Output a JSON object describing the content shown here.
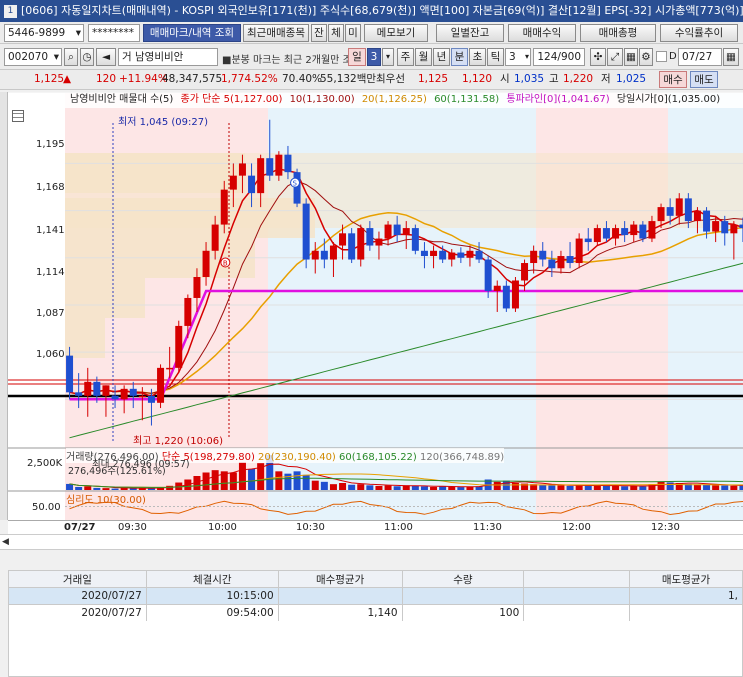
{
  "window": {
    "title": "[0606] 자동일지차트(매매내역) - KOSPI  외국인보유[171(천)]  주식수[68,679(천)]  액면[100]  자본금[69(억)]  결산[12월]  EPS[-32]  시가총액[773(억)]"
  },
  "toolbar1": {
    "account": "5446-9899",
    "password": "********",
    "buttons": [
      "매매마크/내역 조회",
      "최근매매종목",
      "잔",
      "체",
      "미",
      "메모보기",
      "일별잔고",
      "매매수익",
      "매매총평",
      "수익률추이"
    ]
  },
  "toolbar2": {
    "code": "002070",
    "mode": "거",
    "stock_name": "남영비비안",
    "notice": "■분봉 마크는 최근 2개월만 조회",
    "period_day": "일",
    "count_box": "3",
    "periods": [
      "주",
      "월",
      "년",
      "분",
      "초",
      "틱"
    ],
    "interval": "3",
    "paging": "124/900",
    "date": "07/27",
    "check_label": "D"
  },
  "quote": {
    "price": "1,125",
    "change": "120",
    "change_pct": "+11.94%",
    "volume": "48,347,575",
    "volume_pct": "1,774.52%",
    "ratio": "70.40%",
    "amount": "55,132백만",
    "best_label": "최우선",
    "best_ask": "1,125",
    "best_bid": "1,120",
    "open_label": "시",
    "open": "1,035",
    "high_label": "고",
    "high": "1,220",
    "low_label": "저",
    "low": "1,025",
    "buy_btn": "매수",
    "sell_btn": "매도"
  },
  "legend": {
    "name": "남영비비안 매물대 수(5)",
    "ma5": "종가 단순 5(1,127.00)",
    "ma10": "10(1,130.00)",
    "ma20": "20(1,126.25)",
    "ma60": "60(1,131.58)",
    "env": "통파라인[0](1,041.67)",
    "today": "당일시가[0](1,035.00)"
  },
  "price_axis": [
    "1,195",
    "1,168",
    "1,141",
    "1,114",
    "1,087",
    "1,060"
  ],
  "annotations": {
    "low": "최저 1,045 (09:27)",
    "high": "최고 1,220 (10:06)",
    "buy_mark": "B",
    "sell_mark": "S"
  },
  "volume_panel": {
    "legend_main": "거래량(276,496.00)",
    "legend_ma5": "단순 5(198,279.80)",
    "legend_ma20": "20(230,190.40)",
    "legend_ma60": "60(168,105.22)",
    "legend_ma120": "120(366,748.89)",
    "axis": "2,500K",
    "overlay1": "최대 276,496 (09:57)",
    "overlay2": "276,496주(125.61%)"
  },
  "psy_panel": {
    "legend": "심리도 10(30.00)",
    "axis": "50.00"
  },
  "time_axis": [
    "07/27",
    "09:30",
    "10:00",
    "10:30",
    "11:00",
    "11:30",
    "12:00",
    "12:30"
  ],
  "trade_table": {
    "headers": [
      "거래일",
      "체결시간",
      "매수평균가",
      "수량",
      "",
      "매도평균가"
    ],
    "rows": [
      [
        "2020/07/27",
        "10:15:00",
        "",
        "",
        "",
        "1,"
      ],
      [
        "2020/07/27",
        "09:54:00",
        "1,140",
        "100",
        "",
        ""
      ]
    ]
  },
  "colors": {
    "up": "#d60000",
    "down": "#1f4fd0",
    "ma5": "#d60000",
    "ma10": "#a01010",
    "ma20": "#e8a000",
    "ma60": "#2a8a2a",
    "env": "#e010e0"
  },
  "chart_data": {
    "type": "candlestick",
    "y_range": [
      1035,
      1225
    ],
    "candles": [
      {
        "o": 1085,
        "h": 1090,
        "l": 1060,
        "c": 1064,
        "t": "09:00"
      },
      {
        "o": 1064,
        "h": 1075,
        "l": 1055,
        "c": 1062,
        "t": "09:03"
      },
      {
        "o": 1062,
        "h": 1078,
        "l": 1050,
        "c": 1070,
        "t": "09:06"
      },
      {
        "o": 1070,
        "h": 1073,
        "l": 1058,
        "c": 1062,
        "t": "09:09"
      },
      {
        "o": 1062,
        "h": 1068,
        "l": 1050,
        "c": 1068,
        "t": "09:12"
      },
      {
        "o": 1062,
        "h": 1068,
        "l": 1055,
        "c": 1060,
        "t": "09:15"
      },
      {
        "o": 1060,
        "h": 1068,
        "l": 1052,
        "c": 1066,
        "t": "09:18"
      },
      {
        "o": 1066,
        "h": 1070,
        "l": 1055,
        "c": 1062,
        "t": "09:21"
      },
      {
        "o": 1062,
        "h": 1067,
        "l": 1048,
        "c": 1062,
        "t": "09:24"
      },
      {
        "o": 1062,
        "h": 1066,
        "l": 1045,
        "c": 1058,
        "t": "09:27"
      },
      {
        "o": 1058,
        "h": 1080,
        "l": 1055,
        "c": 1078,
        "t": "09:30"
      },
      {
        "o": 1078,
        "h": 1090,
        "l": 1072,
        "c": 1078,
        "t": "09:33"
      },
      {
        "o": 1078,
        "h": 1105,
        "l": 1075,
        "c": 1102,
        "t": "09:36"
      },
      {
        "o": 1102,
        "h": 1120,
        "l": 1095,
        "c": 1118,
        "t": "09:39"
      },
      {
        "o": 1118,
        "h": 1135,
        "l": 1110,
        "c": 1130,
        "t": "09:42"
      },
      {
        "o": 1130,
        "h": 1150,
        "l": 1125,
        "c": 1145,
        "t": "09:45"
      },
      {
        "o": 1145,
        "h": 1165,
        "l": 1140,
        "c": 1160,
        "t": "09:48"
      },
      {
        "o": 1160,
        "h": 1185,
        "l": 1155,
        "c": 1180,
        "t": "09:51"
      },
      {
        "o": 1180,
        "h": 1195,
        "l": 1170,
        "c": 1188,
        "t": "09:54"
      },
      {
        "o": 1188,
        "h": 1200,
        "l": 1178,
        "c": 1195,
        "t": "09:57"
      },
      {
        "o": 1188,
        "h": 1195,
        "l": 1170,
        "c": 1178,
        "t": "10:00"
      },
      {
        "o": 1178,
        "h": 1200,
        "l": 1170,
        "c": 1198,
        "t": "10:03"
      },
      {
        "o": 1198,
        "h": 1220,
        "l": 1185,
        "c": 1188,
        "t": "10:06"
      },
      {
        "o": 1188,
        "h": 1202,
        "l": 1185,
        "c": 1200,
        "t": "10:09"
      },
      {
        "o": 1200,
        "h": 1205,
        "l": 1186,
        "c": 1190,
        "t": "10:12"
      },
      {
        "o": 1190,
        "h": 1192,
        "l": 1170,
        "c": 1172,
        "t": "10:15"
      },
      {
        "o": 1172,
        "h": 1175,
        "l": 1135,
        "c": 1140,
        "t": "10:18"
      },
      {
        "o": 1140,
        "h": 1150,
        "l": 1132,
        "c": 1145,
        "t": "10:21"
      },
      {
        "o": 1145,
        "h": 1152,
        "l": 1135,
        "c": 1140,
        "t": "10:24"
      },
      {
        "o": 1140,
        "h": 1150,
        "l": 1130,
        "c": 1148,
        "t": "10:27"
      },
      {
        "o": 1148,
        "h": 1160,
        "l": 1140,
        "c": 1155,
        "t": "10:30"
      },
      {
        "o": 1155,
        "h": 1158,
        "l": 1138,
        "c": 1140,
        "t": "10:33"
      },
      {
        "o": 1140,
        "h": 1160,
        "l": 1136,
        "c": 1158,
        "t": "10:36"
      },
      {
        "o": 1158,
        "h": 1162,
        "l": 1145,
        "c": 1148,
        "t": "10:39"
      },
      {
        "o": 1148,
        "h": 1156,
        "l": 1140,
        "c": 1152,
        "t": "10:42"
      },
      {
        "o": 1152,
        "h": 1162,
        "l": 1148,
        "c": 1160,
        "t": "10:45"
      },
      {
        "o": 1160,
        "h": 1165,
        "l": 1150,
        "c": 1154,
        "t": "10:48"
      },
      {
        "o": 1154,
        "h": 1162,
        "l": 1146,
        "c": 1158,
        "t": "10:51"
      },
      {
        "o": 1158,
        "h": 1160,
        "l": 1143,
        "c": 1145,
        "t": "10:54"
      },
      {
        "o": 1145,
        "h": 1150,
        "l": 1135,
        "c": 1142,
        "t": "10:57"
      },
      {
        "o": 1142,
        "h": 1148,
        "l": 1135,
        "c": 1145,
        "t": "11:00"
      },
      {
        "o": 1145,
        "h": 1148,
        "l": 1138,
        "c": 1140,
        "t": "11:03"
      },
      {
        "o": 1140,
        "h": 1146,
        "l": 1136,
        "c": 1144,
        "t": "11:06"
      },
      {
        "o": 1144,
        "h": 1147,
        "l": 1138,
        "c": 1141,
        "t": "11:09"
      },
      {
        "o": 1141,
        "h": 1148,
        "l": 1136,
        "c": 1145,
        "t": "11:12"
      },
      {
        "o": 1145,
        "h": 1150,
        "l": 1138,
        "c": 1140,
        "t": "11:15"
      },
      {
        "o": 1140,
        "h": 1142,
        "l": 1118,
        "c": 1122,
        "t": "11:18"
      },
      {
        "o": 1122,
        "h": 1128,
        "l": 1110,
        "c": 1125,
        "t": "11:21"
      },
      {
        "o": 1125,
        "h": 1128,
        "l": 1110,
        "c": 1112,
        "t": "11:24"
      },
      {
        "o": 1112,
        "h": 1130,
        "l": 1110,
        "c": 1128,
        "t": "11:27"
      },
      {
        "o": 1128,
        "h": 1140,
        "l": 1122,
        "c": 1138,
        "t": "11:30"
      },
      {
        "o": 1138,
        "h": 1148,
        "l": 1132,
        "c": 1145,
        "t": "11:33"
      },
      {
        "o": 1145,
        "h": 1150,
        "l": 1136,
        "c": 1140,
        "t": "11:36"
      },
      {
        "o": 1140,
        "h": 1145,
        "l": 1130,
        "c": 1135,
        "t": "11:39"
      },
      {
        "o": 1135,
        "h": 1145,
        "l": 1132,
        "c": 1142,
        "t": "11:42"
      },
      {
        "o": 1142,
        "h": 1150,
        "l": 1135,
        "c": 1138,
        "t": "11:45"
      },
      {
        "o": 1138,
        "h": 1155,
        "l": 1135,
        "c": 1152,
        "t": "11:48"
      },
      {
        "o": 1152,
        "h": 1158,
        "l": 1145,
        "c": 1150,
        "t": "11:51"
      },
      {
        "o": 1150,
        "h": 1160,
        "l": 1148,
        "c": 1158,
        "t": "11:54"
      },
      {
        "o": 1158,
        "h": 1162,
        "l": 1150,
        "c": 1152,
        "t": "11:57"
      },
      {
        "o": 1152,
        "h": 1160,
        "l": 1148,
        "c": 1158,
        "t": "12:00"
      },
      {
        "o": 1158,
        "h": 1162,
        "l": 1150,
        "c": 1154,
        "t": "12:03"
      },
      {
        "o": 1154,
        "h": 1162,
        "l": 1150,
        "c": 1160,
        "t": "12:06"
      },
      {
        "o": 1160,
        "h": 1162,
        "l": 1150,
        "c": 1152,
        "t": "12:09"
      },
      {
        "o": 1152,
        "h": 1165,
        "l": 1150,
        "c": 1162,
        "t": "12:12"
      },
      {
        "o": 1162,
        "h": 1172,
        "l": 1158,
        "c": 1170,
        "t": "12:15"
      },
      {
        "o": 1170,
        "h": 1175,
        "l": 1160,
        "c": 1165,
        "t": "12:18"
      },
      {
        "o": 1165,
        "h": 1178,
        "l": 1160,
        "c": 1175,
        "t": "12:21"
      },
      {
        "o": 1175,
        "h": 1178,
        "l": 1158,
        "c": 1162,
        "t": "12:24"
      },
      {
        "o": 1162,
        "h": 1170,
        "l": 1155,
        "c": 1168,
        "t": "12:27"
      },
      {
        "o": 1168,
        "h": 1170,
        "l": 1152,
        "c": 1156,
        "t": "12:30"
      },
      {
        "o": 1156,
        "h": 1165,
        "l": 1150,
        "c": 1162,
        "t": "12:33"
      },
      {
        "o": 1162,
        "h": 1165,
        "l": 1148,
        "c": 1155,
        "t": "12:36"
      },
      {
        "o": 1155,
        "h": 1162,
        "l": 1140,
        "c": 1160,
        "t": "12:39"
      },
      {
        "o": 1160,
        "h": 1164,
        "l": 1150,
        "c": 1158,
        "t": "12:42"
      },
      {
        "o": 1158,
        "h": 1168,
        "l": 1150,
        "c": 1162,
        "t": "12:45"
      },
      {
        "o": 1162,
        "h": 1170,
        "l": 1155,
        "c": 1160,
        "t": "12:48"
      }
    ],
    "volumes": [
      520,
      260,
      310,
      180,
      160,
      120,
      170,
      200,
      150,
      130,
      240,
      360,
      640,
      900,
      1200,
      1500,
      1700,
      1600,
      1500,
      2400,
      1800,
      2300,
      3000,
      1600,
      1400,
      1600,
      1300,
      800,
      700,
      500,
      600,
      450,
      500,
      400,
      350,
      380,
      320,
      400,
      350,
      300,
      260,
      300,
      270,
      250,
      300,
      320,
      900,
      700,
      800,
      600,
      550,
      500,
      420,
      380,
      400,
      350,
      420,
      380,
      400,
      350,
      380,
      320,
      350,
      300,
      500,
      700,
      650,
      600,
      520,
      480,
      450,
      400,
      380,
      360,
      400,
      380,
      420
    ],
    "env_line": {
      "start_y": 1060,
      "rise_to": 1122,
      "rise_end_index": 15
    }
  }
}
